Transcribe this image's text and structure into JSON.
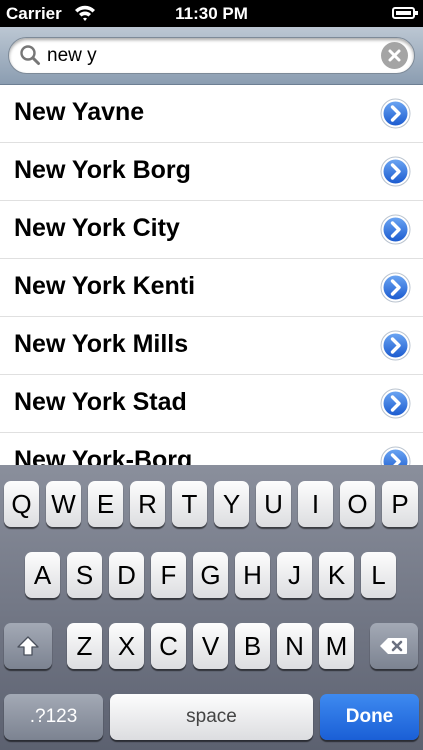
{
  "status_bar": {
    "carrier": "Carrier",
    "time": "11:30 PM"
  },
  "search": {
    "query": "new y"
  },
  "results": [
    {
      "label": "New Yavne"
    },
    {
      "label": "New York Borg"
    },
    {
      "label": "New York City"
    },
    {
      "label": "New York Kenti"
    },
    {
      "label": "New York Mills"
    },
    {
      "label": "New York Stad"
    },
    {
      "label": "New York-Borg"
    }
  ],
  "keyboard": {
    "row1": [
      "Q",
      "W",
      "E",
      "R",
      "T",
      "Y",
      "U",
      "I",
      "O",
      "P"
    ],
    "row2": [
      "A",
      "S",
      "D",
      "F",
      "G",
      "H",
      "J",
      "K",
      "L"
    ],
    "row3": [
      "Z",
      "X",
      "C",
      "V",
      "B",
      "N",
      "M"
    ],
    "numbers_label": ".?123",
    "space_label": "space",
    "done_label": "Done"
  },
  "colors": {
    "accent": "#1a5fd6",
    "disclosure": "#2a6fd6"
  }
}
